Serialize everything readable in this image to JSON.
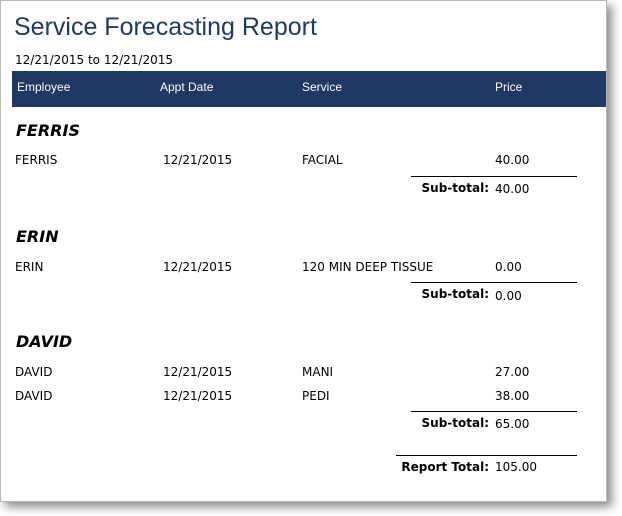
{
  "report": {
    "title": "Service Forecasting Report",
    "date_range": "12/21/2015 to 12/21/2015"
  },
  "columns": [
    "Employee",
    "Appt Date",
    "Service",
    "Price"
  ],
  "colors": {
    "header_bg": "#1f3864",
    "title": "#1f3864"
  },
  "groups": [
    {
      "name": "FERRIS",
      "rows": [
        {
          "employee": "FERRIS",
          "date": "12/21/2015",
          "service": "FACIAL",
          "price": "40.00"
        }
      ],
      "subtotal_label": "Sub-total:",
      "subtotal": "40.00"
    },
    {
      "name": "ERIN",
      "rows": [
        {
          "employee": "ERIN",
          "date": "12/21/2015",
          "service": "120 MIN DEEP TISSUE",
          "price": "0.00"
        }
      ],
      "subtotal_label": "Sub-total:",
      "subtotal": "0.00"
    },
    {
      "name": "DAVID",
      "rows": [
        {
          "employee": "DAVID",
          "date": "12/21/2015",
          "service": "MANI",
          "price": "27.00"
        },
        {
          "employee": "DAVID",
          "date": "12/21/2015",
          "service": "PEDI",
          "price": "38.00"
        }
      ],
      "subtotal_label": "Sub-total:",
      "subtotal": "65.00"
    }
  ],
  "total": {
    "label": "Report Total:",
    "value": "105.00"
  }
}
